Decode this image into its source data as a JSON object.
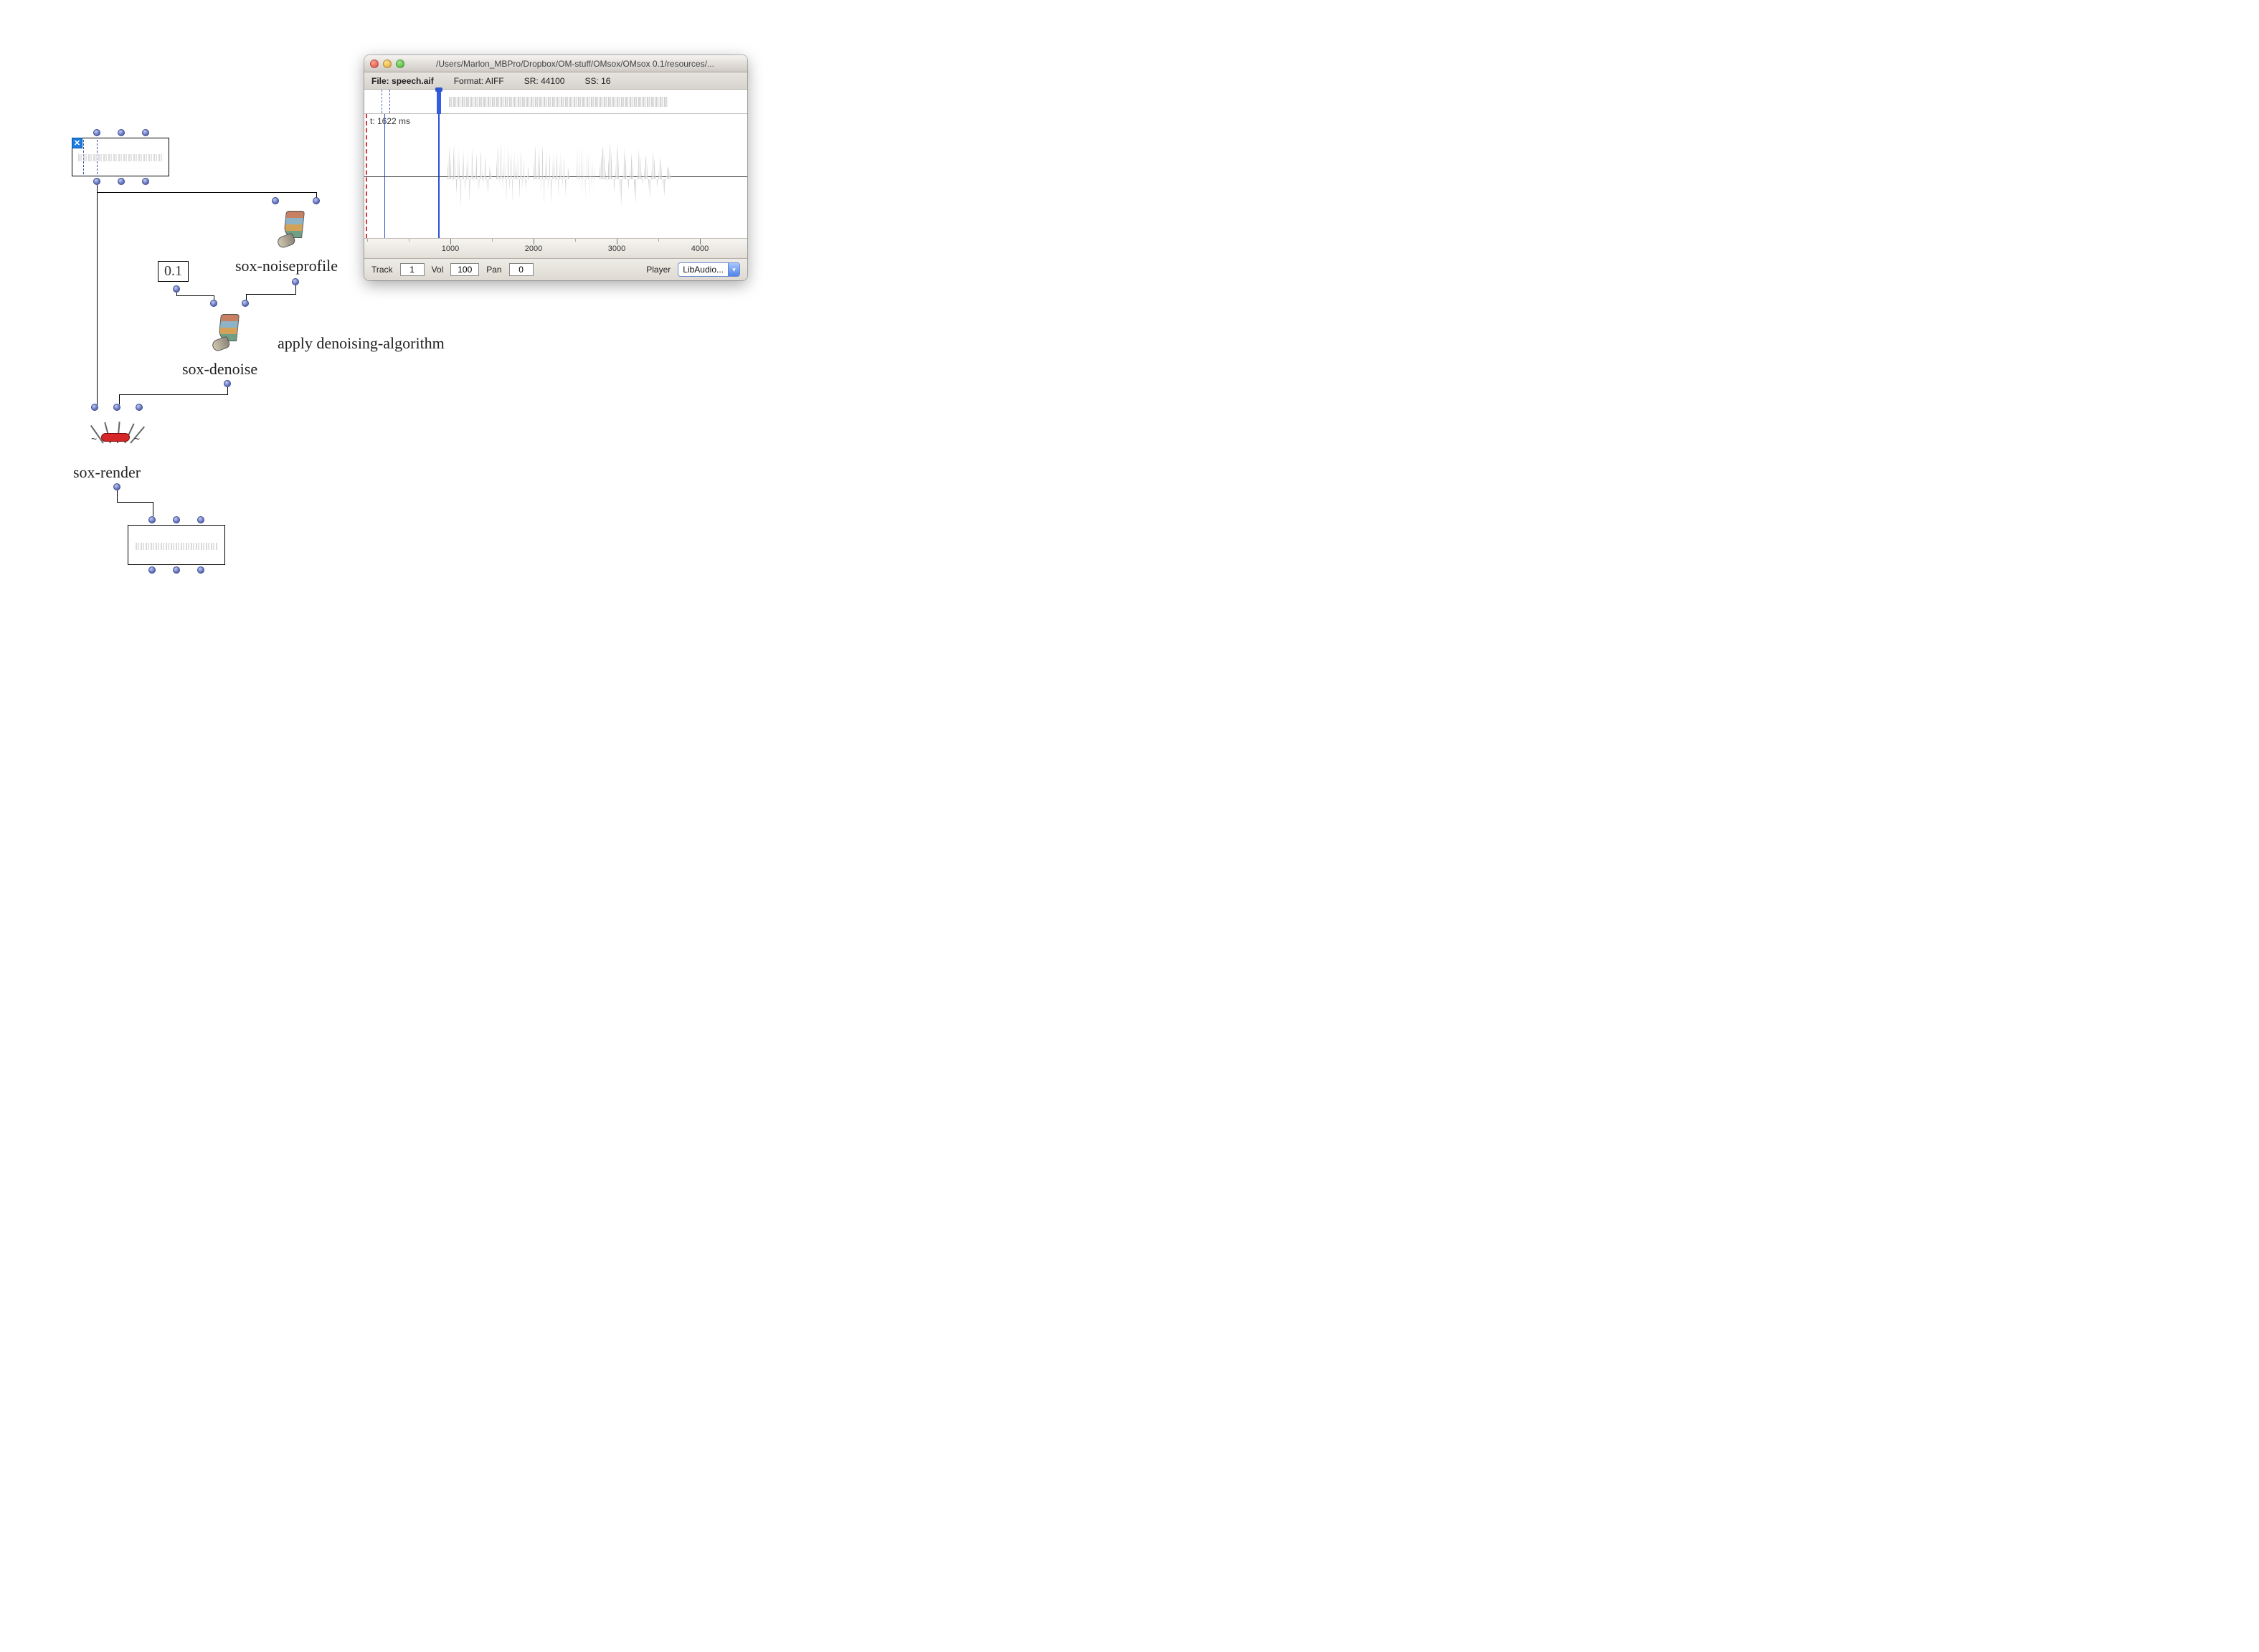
{
  "patch": {
    "value_box": "0.1",
    "noiseprofile_label": "sox-noiseprofile",
    "denoise_label": "sox-denoise",
    "render_label": "sox-render",
    "comment": "apply denoising-algorithm"
  },
  "window": {
    "title": "/Users/Marlon_MBPro/Dropbox/OM-stuff/OMsox/OMsox 0.1/resources/...",
    "file_label": "File: ",
    "file_name": "speech.aif",
    "format": "Format: AIFF",
    "sr": "SR: 44100",
    "ss": "SS: 16",
    "cursor_time": "t: 1622 ms",
    "ruler_ticks": [
      "1000",
      "2000",
      "3000",
      "4000"
    ],
    "controls": {
      "track_label": "Track",
      "track_value": "1",
      "vol_label": "Vol",
      "vol_value": "100",
      "pan_label": "Pan",
      "pan_value": "0",
      "player_label": "Player",
      "player_selected": "LibAudio..."
    }
  }
}
